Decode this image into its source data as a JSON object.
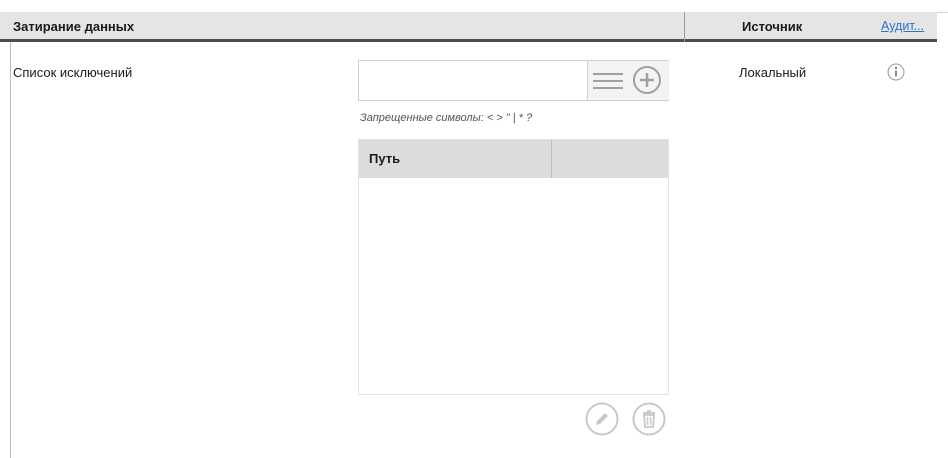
{
  "section": {
    "title": "Затирание данных",
    "source_header": "Источник",
    "audit_link": "Аудит..."
  },
  "setting": {
    "label": "Список исключений",
    "input_value": "",
    "input_placeholder": "",
    "hint": "Запрещенные символы: < > \" | * ?",
    "source_value": "Локальный"
  },
  "table": {
    "columns": [
      "Путь",
      ""
    ],
    "rows": []
  },
  "icons": {
    "list": "list-icon",
    "add": "plus-circle-icon",
    "info": "info-icon",
    "edit": "pencil-icon",
    "delete": "trash-icon"
  },
  "colors": {
    "header_bg": "#e5e5e5",
    "header_underline": "#4d4d4d",
    "link": "#2f6fc9",
    "icon_gray": "#a0a0a0"
  }
}
